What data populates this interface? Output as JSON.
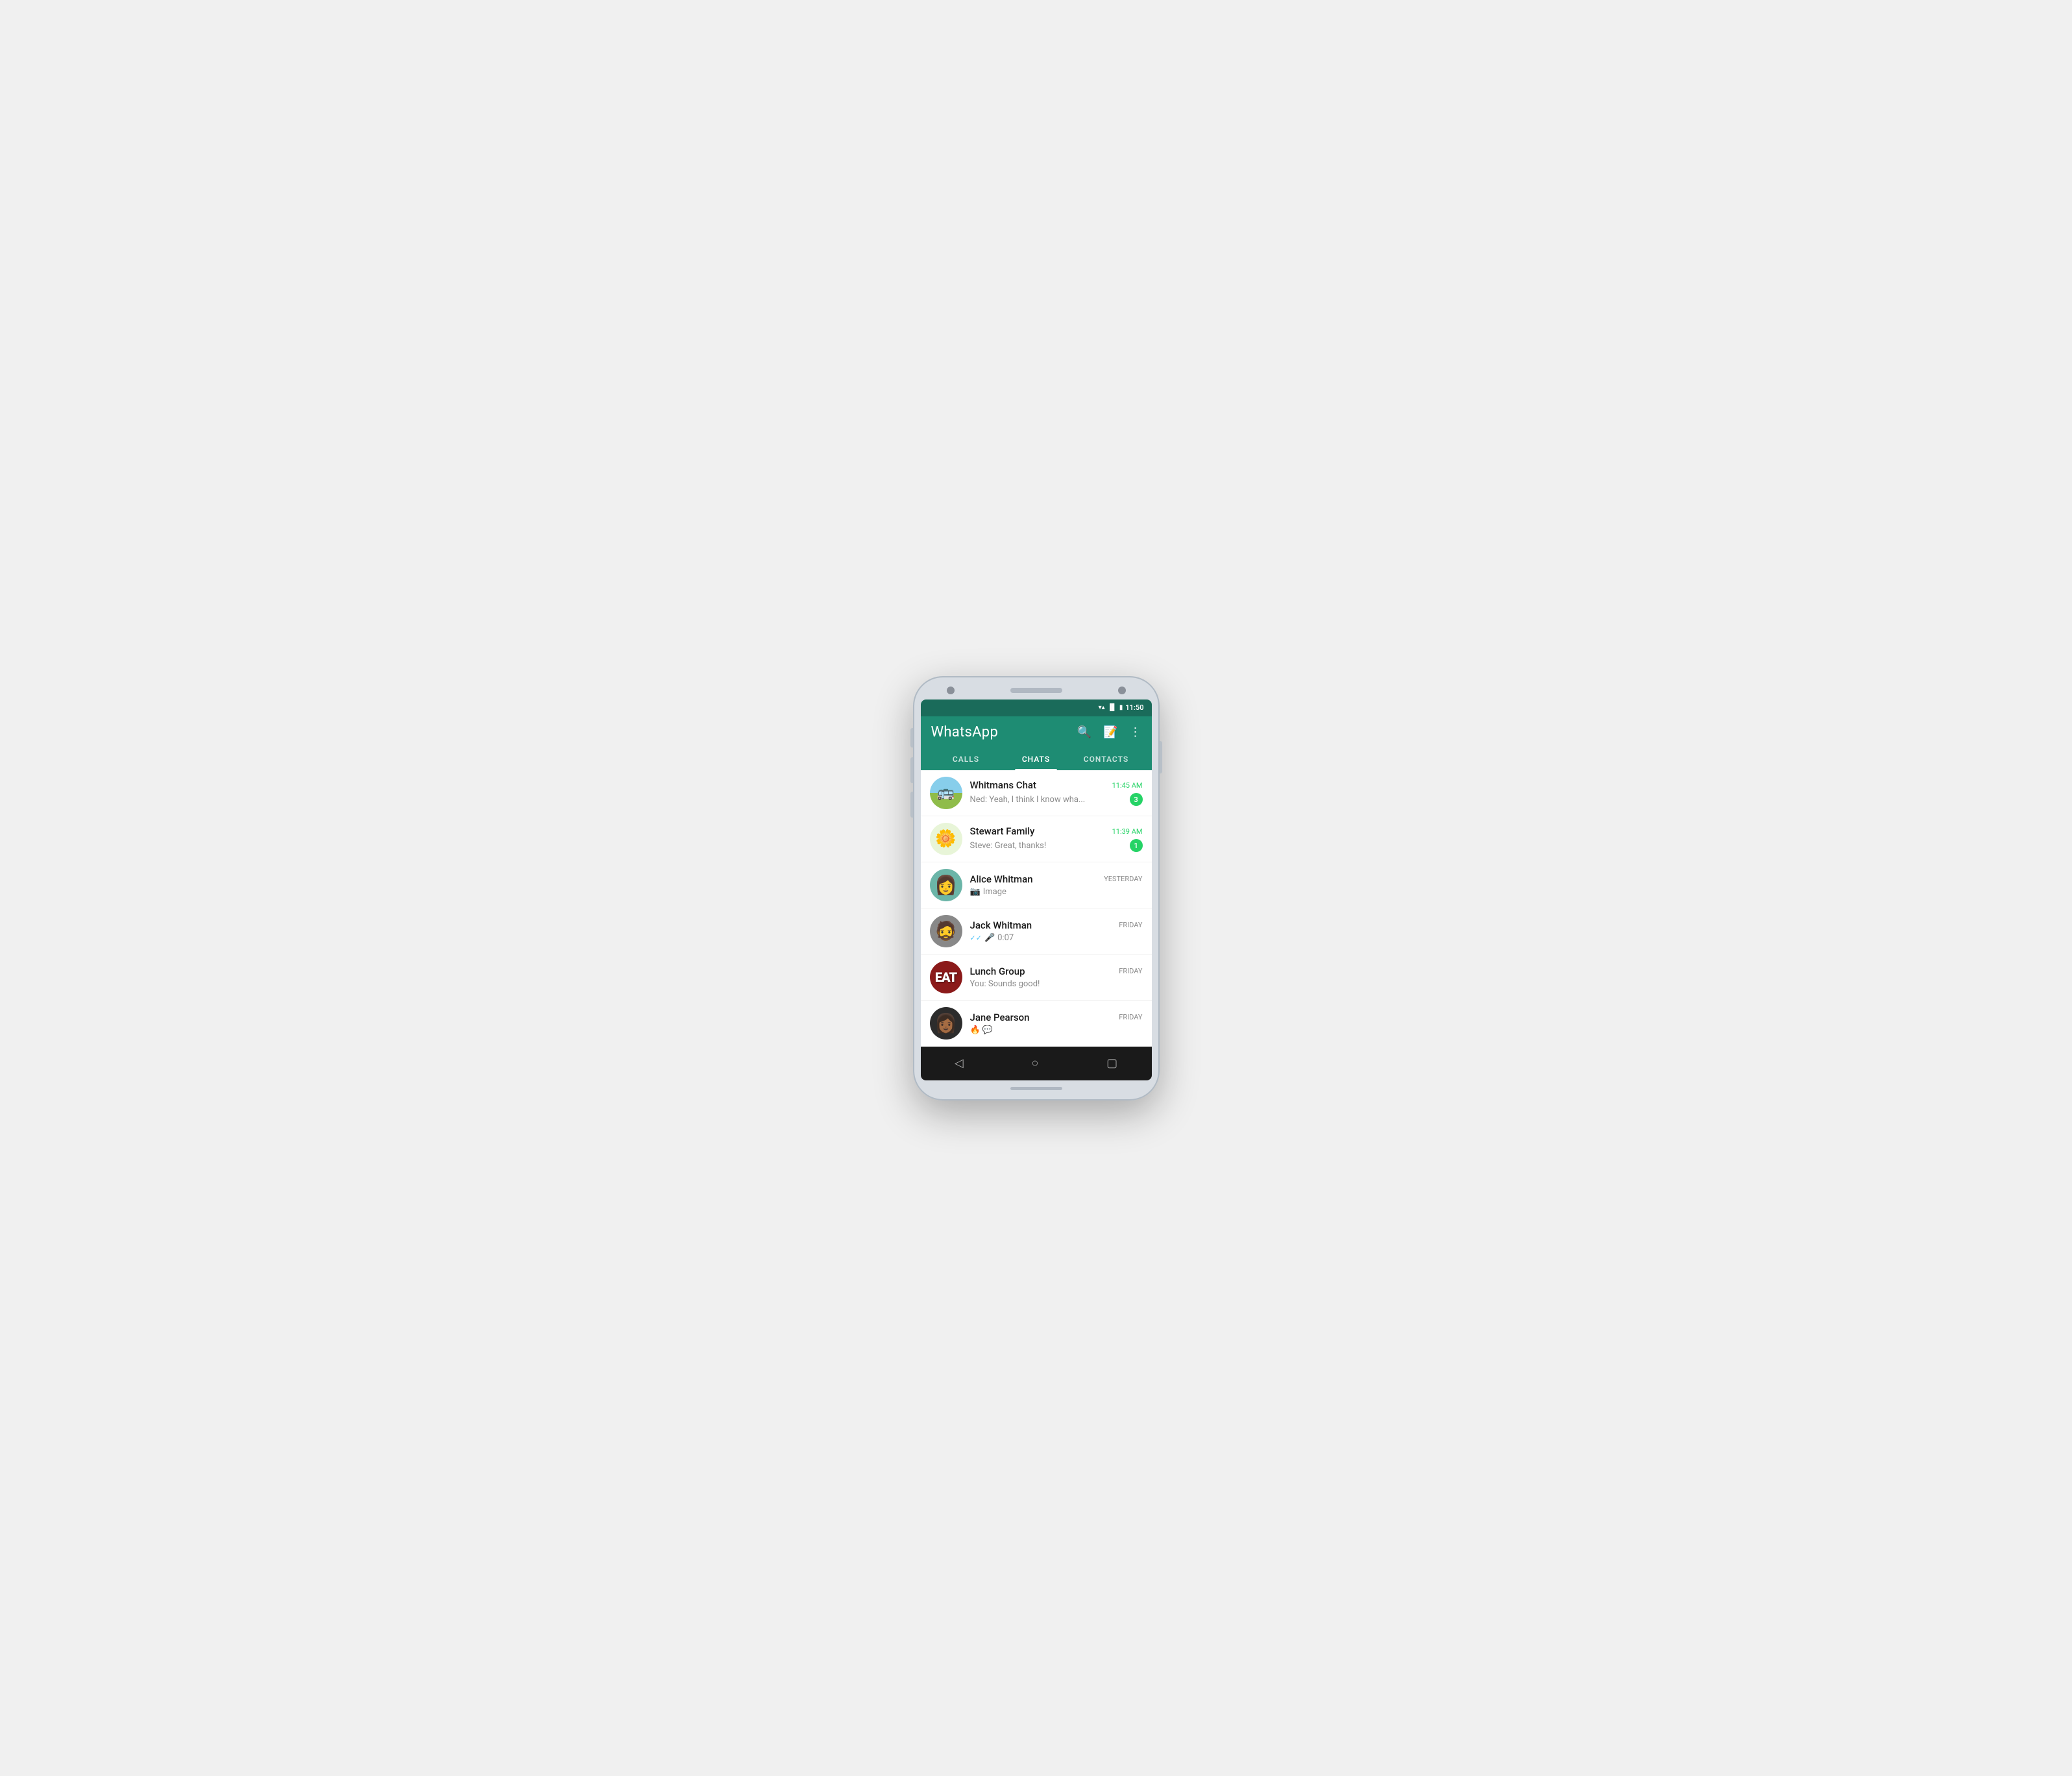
{
  "status_bar": {
    "time": "11:50"
  },
  "header": {
    "title": "WhatsApp",
    "bg_color": "#1e8c73"
  },
  "tabs": [
    {
      "id": "calls",
      "label": "CALLS",
      "active": false
    },
    {
      "id": "chats",
      "label": "CHATS",
      "active": true
    },
    {
      "id": "contacts",
      "label": "CONTACTS",
      "active": false
    }
  ],
  "chats": [
    {
      "id": "whitmans",
      "name": "Whitmans Chat",
      "preview": "Ned: Yeah, I think I know wha...",
      "time": "11:45 AM",
      "time_style": "green",
      "unread": "3",
      "avatar_type": "whitmans"
    },
    {
      "id": "stewart",
      "name": "Stewart Family",
      "preview": "Steve: Great, thanks!",
      "time": "11:39 AM",
      "time_style": "green",
      "unread": "1",
      "avatar_type": "stewart"
    },
    {
      "id": "alice",
      "name": "Alice Whitman",
      "preview": "Image",
      "time": "YESTERDAY",
      "time_style": "grey",
      "unread": "",
      "avatar_type": "alice",
      "has_camera": true
    },
    {
      "id": "jack",
      "name": "Jack Whitman",
      "preview": "0:07",
      "time": "FRIDAY",
      "time_style": "grey",
      "unread": "",
      "avatar_type": "jack",
      "has_check": true,
      "has_mic": true
    },
    {
      "id": "lunch",
      "name": "Lunch Group",
      "preview": "You: Sounds good!",
      "time": "FRIDAY",
      "time_style": "grey",
      "unread": "",
      "avatar_type": "lunch"
    },
    {
      "id": "jane",
      "name": "Jane Pearson",
      "preview": "🔥 💬",
      "time": "FRIDAY",
      "time_style": "grey",
      "unread": "",
      "avatar_type": "jane"
    }
  ],
  "bottom_nav": {
    "back": "◁",
    "home": "○",
    "recent": "▢"
  }
}
